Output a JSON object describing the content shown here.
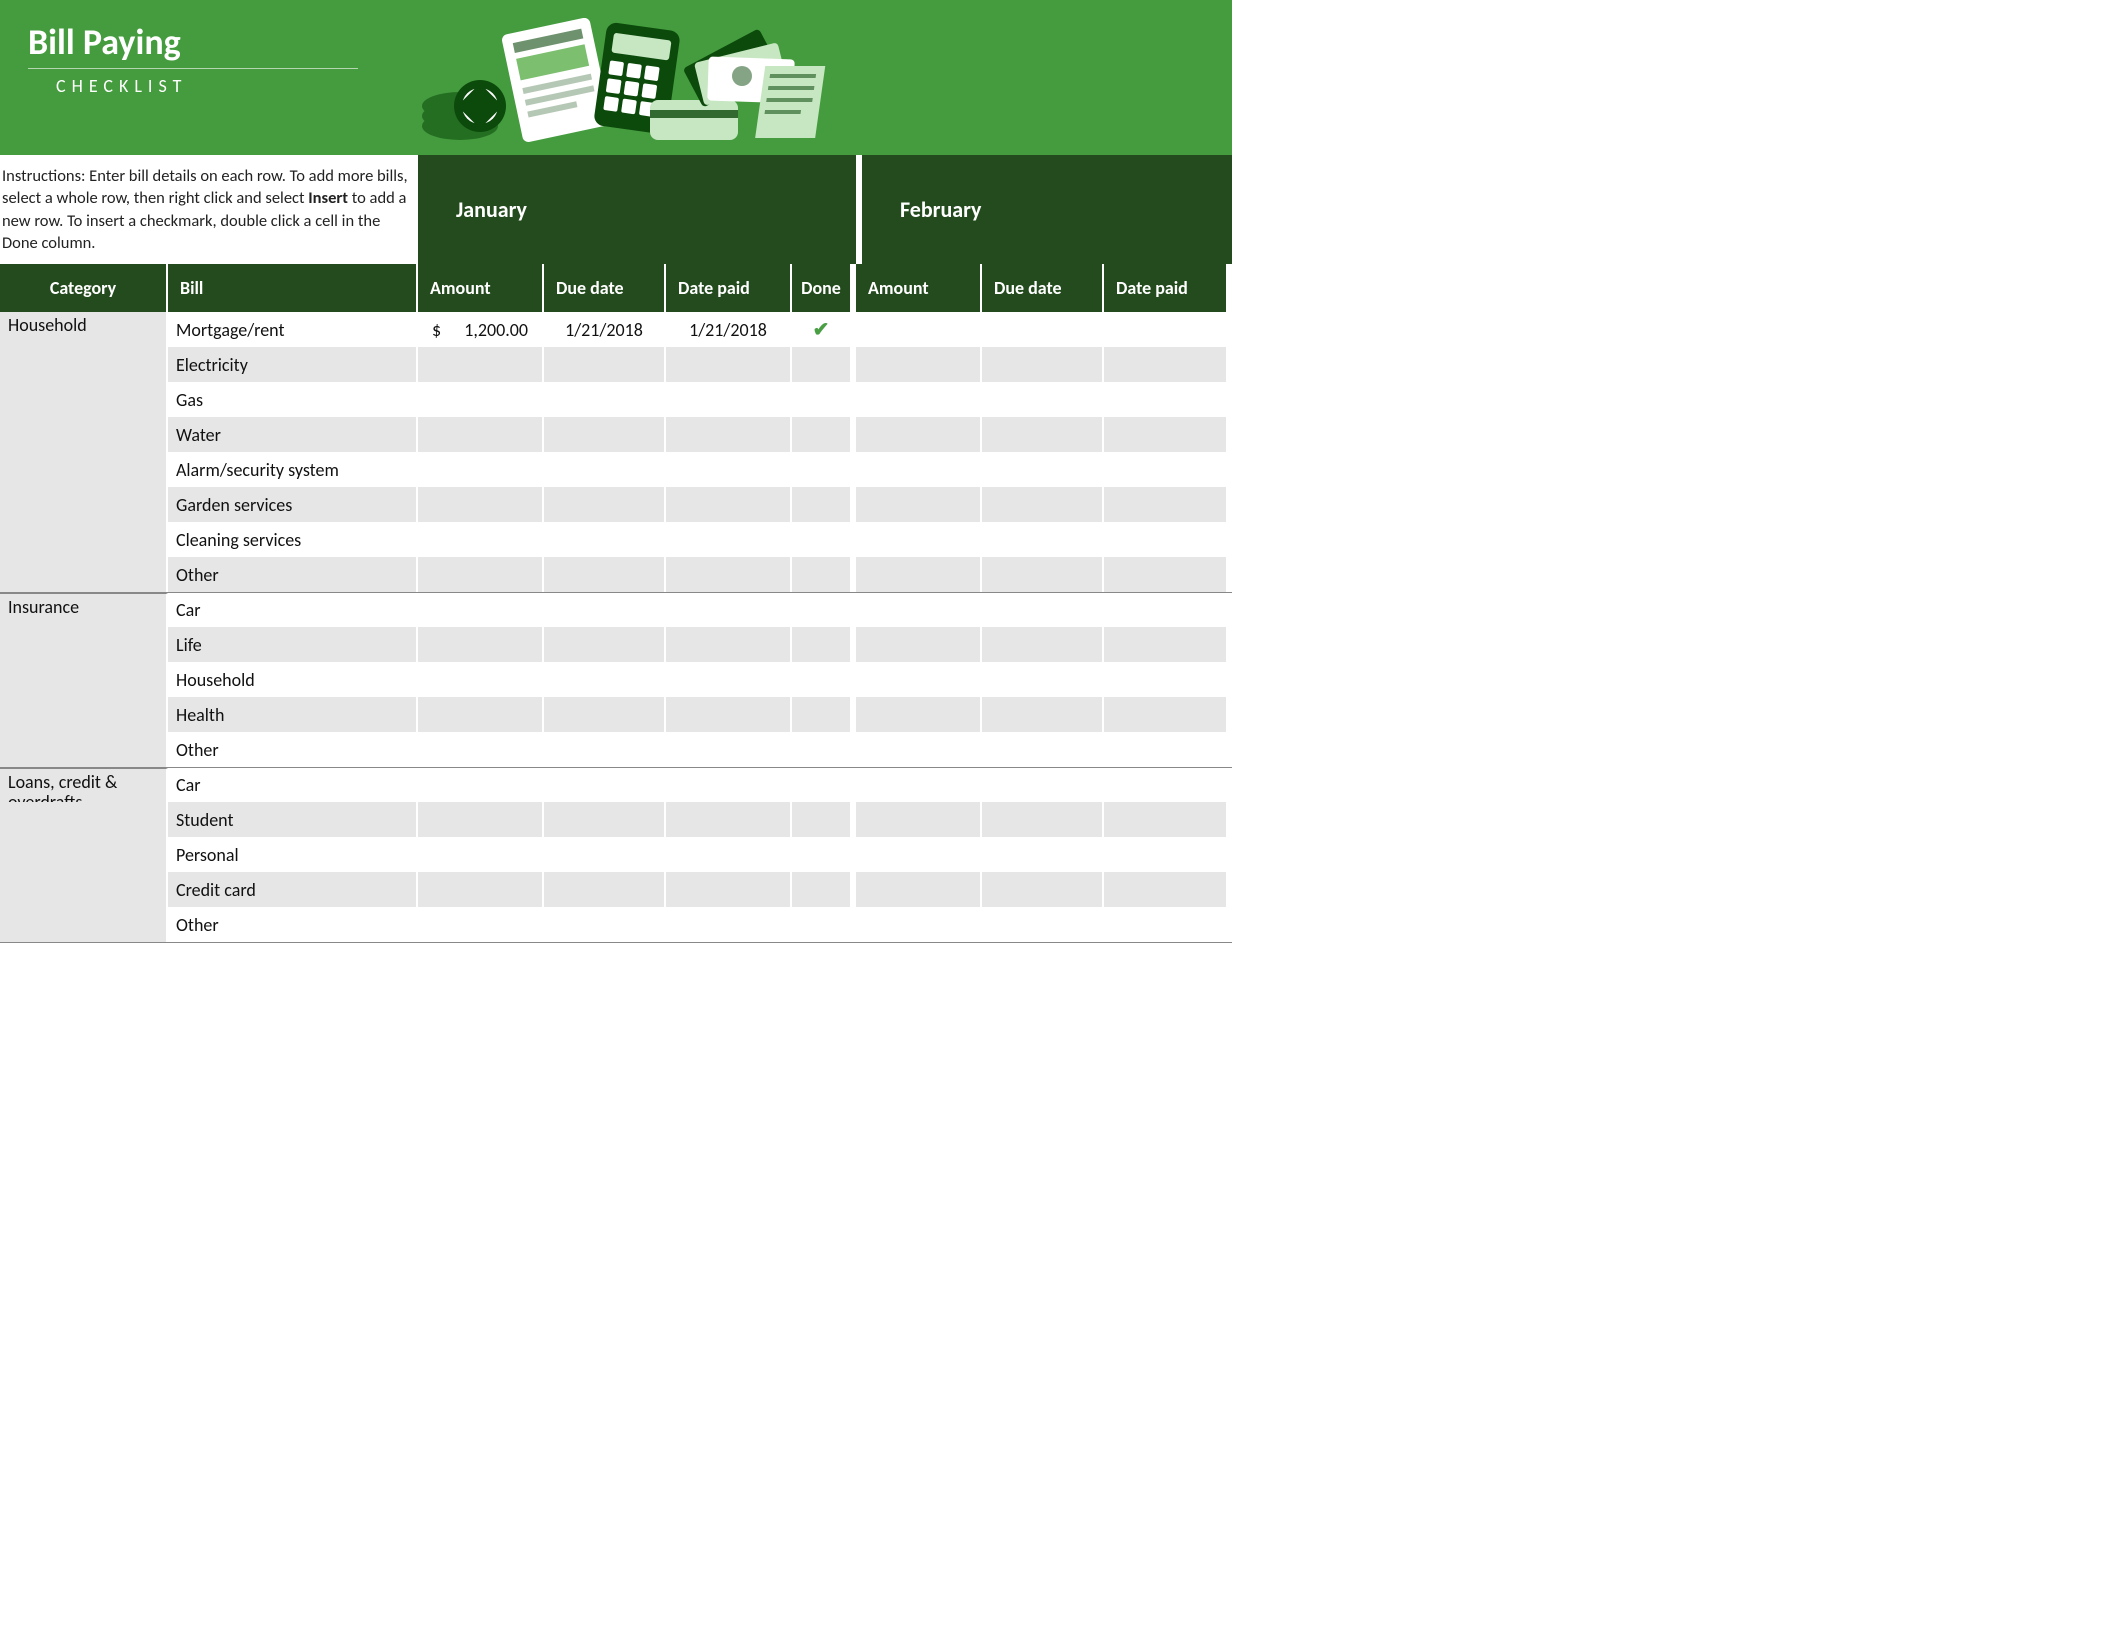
{
  "banner": {
    "title": "Bill Paying",
    "subtitle": "CHECKLIST"
  },
  "instructions_html": "Instructions: Enter bill details on each row. To add more bills, select a whole row, then right click and select <b>Insert</b> to add a new row. To insert a checkmark, double click a cell in the Done column.",
  "months": {
    "m1": "January",
    "m2": "February"
  },
  "headers": {
    "category": "Category",
    "bill": "Bill",
    "amount": "Amount",
    "due": "Due date",
    "paid": "Date paid",
    "done": "Done"
  },
  "groups": [
    {
      "category": "Household",
      "rows": [
        {
          "bill": "Mortgage/rent",
          "m1": {
            "amount_sym": "$",
            "amount_val": "1,200.00",
            "due": "1/21/2018",
            "paid": "1/21/2018",
            "done": true
          }
        },
        {
          "bill": "Electricity"
        },
        {
          "bill": "Gas"
        },
        {
          "bill": "Water"
        },
        {
          "bill": "Alarm/security system"
        },
        {
          "bill": "Garden services"
        },
        {
          "bill": "Cleaning services"
        },
        {
          "bill": "Other"
        }
      ]
    },
    {
      "category": "Insurance",
      "rows": [
        {
          "bill": "Car"
        },
        {
          "bill": "Life"
        },
        {
          "bill": "Household"
        },
        {
          "bill": "Health"
        },
        {
          "bill": "Other"
        }
      ]
    },
    {
      "category": "Loans, credit & overdrafts",
      "rows": [
        {
          "bill": "Car"
        },
        {
          "bill": "Student"
        },
        {
          "bill": "Personal"
        },
        {
          "bill": "Credit card"
        },
        {
          "bill": "Other"
        }
      ]
    }
  ]
}
